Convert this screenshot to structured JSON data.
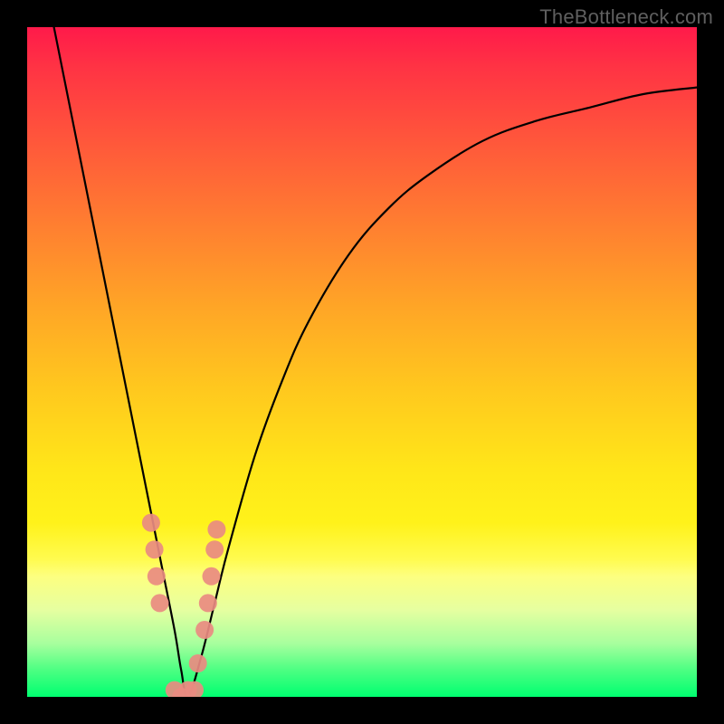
{
  "watermark": "TheBottleneck.com",
  "chart_data": {
    "type": "line",
    "title": "",
    "xlabel": "",
    "ylabel": "",
    "xlim": [
      0,
      100
    ],
    "ylim": [
      0,
      100
    ],
    "grid": false,
    "legend": false,
    "background_gradient": {
      "direction": "vertical",
      "stops": [
        {
          "pos": 0.0,
          "color": "#ff1a4a"
        },
        {
          "pos": 0.18,
          "color": "#ff5a3a"
        },
        {
          "pos": 0.42,
          "color": "#ffa626"
        },
        {
          "pos": 0.66,
          "color": "#ffe619"
        },
        {
          "pos": 0.82,
          "color": "#fdff80"
        },
        {
          "pos": 0.92,
          "color": "#a8ff9e"
        },
        {
          "pos": 1.0,
          "color": "#00ff70"
        }
      ]
    },
    "series": [
      {
        "name": "bottleneck-curve",
        "type": "line",
        "color": "#000000",
        "x": [
          4,
          6,
          8,
          10,
          12,
          14,
          16,
          18,
          20,
          22,
          23,
          24,
          26,
          28,
          30,
          34,
          38,
          42,
          48,
          54,
          60,
          68,
          76,
          84,
          92,
          100
        ],
        "y": [
          100,
          90,
          80,
          70,
          60,
          50,
          40,
          30,
          20,
          10,
          4,
          0,
          6,
          14,
          22,
          36,
          47,
          56,
          66,
          73,
          78,
          83,
          86,
          88,
          90,
          91
        ]
      },
      {
        "name": "data-points",
        "type": "scatter",
        "color": "#e98b81",
        "x": [
          18.5,
          19.0,
          19.3,
          19.8,
          22.0,
          23.0,
          24.0,
          25.0,
          25.5,
          26.5,
          27.0,
          27.5,
          28.0,
          28.3
        ],
        "y": [
          26,
          22,
          18,
          14,
          1,
          0,
          1,
          1,
          5,
          10,
          14,
          18,
          22,
          25
        ]
      }
    ],
    "notes": "V-shaped bottleneck curve over a red-to-green vertical gradient; y encodes bottleneck severity (red high, green low). Axes not labeled in source; values are percentages 0–100 estimated from geometry."
  }
}
